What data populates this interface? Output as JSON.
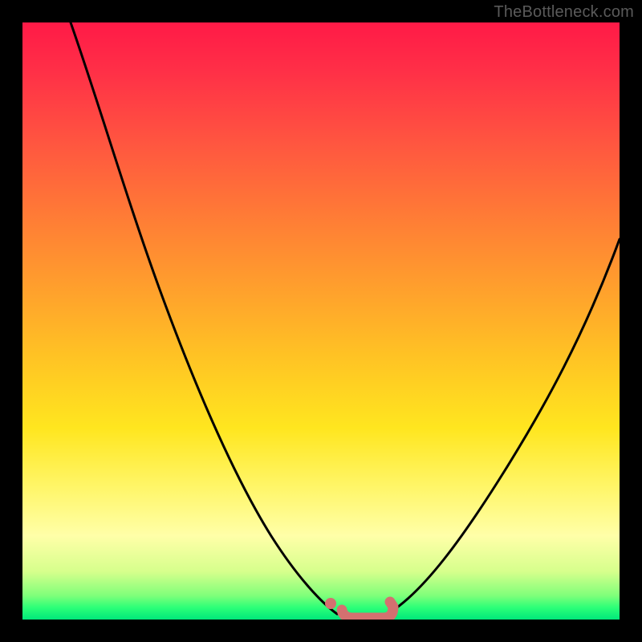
{
  "watermark": "TheBottleneck.com",
  "colors": {
    "curve": "#000000",
    "marker": "#d47070",
    "frame": "#000000"
  },
  "chart_data": {
    "type": "line",
    "title": "",
    "xlabel": "",
    "ylabel": "",
    "xlim": [
      0,
      100
    ],
    "ylim": [
      0,
      100
    ],
    "annotations": [
      "TheBottleneck.com"
    ],
    "series": [
      {
        "name": "left-curve",
        "x": [
          8,
          12,
          16,
          20,
          24,
          28,
          32,
          36,
          40,
          44,
          47,
          50,
          52
        ],
        "values": [
          100,
          90,
          81,
          72,
          63,
          54,
          45,
          36,
          27,
          18,
          10,
          4,
          2
        ]
      },
      {
        "name": "right-curve",
        "x": [
          60,
          64,
          68,
          72,
          76,
          80,
          84,
          88,
          92,
          96,
          100
        ],
        "values": [
          2,
          5,
          10,
          16,
          22,
          29,
          36,
          44,
          52,
          59,
          66
        ]
      },
      {
        "name": "flat-bottom",
        "x": [
          52,
          54,
          56,
          58,
          60
        ],
        "values": [
          2,
          2,
          2,
          2,
          2
        ]
      }
    ],
    "markers": [
      {
        "name": "left-dot",
        "x": 50,
        "y": 3
      },
      {
        "name": "valley-bar",
        "x_start": 52,
        "x_end": 60,
        "y": 2
      }
    ]
  }
}
